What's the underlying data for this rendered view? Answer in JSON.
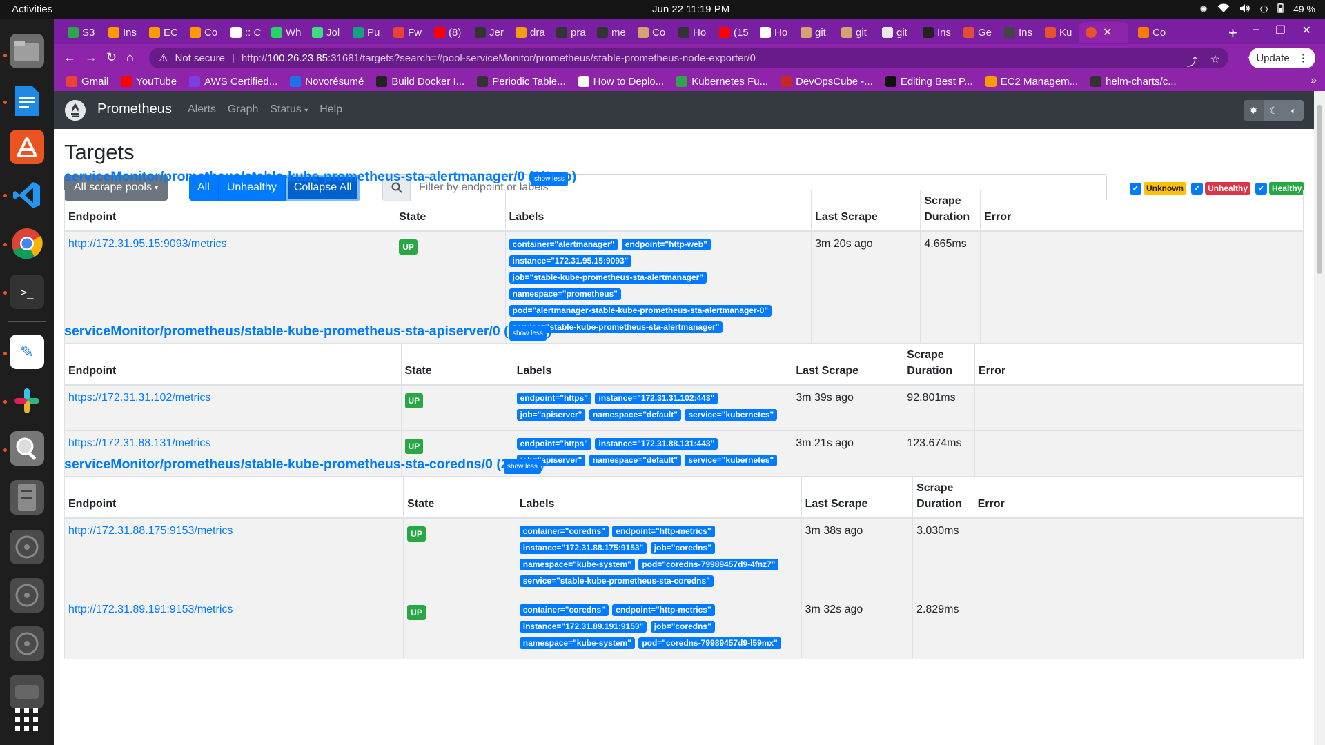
{
  "system": {
    "activities": "Activities",
    "clock": "Jun 22  11:19 PM",
    "battery": "49 %"
  },
  "browser": {
    "tabs": [
      {
        "label": "S3",
        "color": "#2ea44f"
      },
      {
        "label": "Ins",
        "color": "#ff9900"
      },
      {
        "label": "EC",
        "color": "#ff9900"
      },
      {
        "label": "Co",
        "color": "#ff9900"
      },
      {
        "label": ":: C",
        "color": "#ffffff"
      },
      {
        "label": "Wh",
        "color": "#25d366"
      },
      {
        "label": "Jol",
        "color": "#3ddc84"
      },
      {
        "label": "Pu",
        "color": "#10a37f"
      },
      {
        "label": "Fw",
        "color": "#ea4335"
      },
      {
        "label": "(8)",
        "color": "#ff0000"
      },
      {
        "label": "Jer",
        "color": "#333333"
      },
      {
        "label": "dra",
        "color": "#f59e0b"
      },
      {
        "label": "pra",
        "color": "#333333"
      },
      {
        "label": "me",
        "color": "#333333"
      },
      {
        "label": "Co",
        "color": "#d4a373"
      },
      {
        "label": "Ho",
        "color": "#333333"
      },
      {
        "label": "(15",
        "color": "#ff0000"
      },
      {
        "label": "Ho",
        "color": "#ffffff"
      },
      {
        "label": "git",
        "color": "#d4a373"
      },
      {
        "label": "git",
        "color": "#d4a373"
      },
      {
        "label": "git",
        "color": "#e8e8e8"
      },
      {
        "label": "Ins",
        "color": "#222222"
      },
      {
        "label": "Ge",
        "color": "#e04e39"
      },
      {
        "label": "Ins",
        "color": "#444444"
      },
      {
        "label": "Ku",
        "color": "#e6522c"
      }
    ],
    "active_tab": {
      "label": "",
      "color": "#e6522c"
    },
    "last_tab": {
      "label": "Co",
      "color": "#f57c00"
    },
    "address": {
      "not_secure": "Not secure",
      "url_prefix": "http://",
      "url_host": "100.26.23.85",
      "url_rest": ":31681/targets?search=#pool-serviceMonitor/prometheus/stable-prometheus-node-exporter/0"
    },
    "update_label": "Update",
    "bookmarks": [
      {
        "label": "Gmail",
        "color": "#ea4335"
      },
      {
        "label": "YouTube",
        "color": "#ff0000"
      },
      {
        "label": "AWS Certified...",
        "color": "#7b3fe4"
      },
      {
        "label": "Novorésumé",
        "color": "#1a73e8"
      },
      {
        "label": "Build Docker I...",
        "color": "#222222"
      },
      {
        "label": "Periodic Table...",
        "color": "#333333"
      },
      {
        "label": "How to Deplo...",
        "color": "#ffffff"
      },
      {
        "label": "Kubernetes Fu...",
        "color": "#2ea44f"
      },
      {
        "label": "DevOpsCube -...",
        "color": "#c62828"
      },
      {
        "label": "Editing Best P...",
        "color": "#111111"
      },
      {
        "label": "EC2 Managem...",
        "color": "#ff9900"
      },
      {
        "label": "helm-charts/c...",
        "color": "#333333"
      }
    ]
  },
  "prometheus": {
    "brand": "Prometheus",
    "nav": [
      "Alerts",
      "Graph",
      "Status",
      "Help"
    ],
    "page_title": "Targets",
    "pool_button": "All scrape pools",
    "filters": [
      "All",
      "Unhealthy",
      "Collapse All"
    ],
    "search_placeholder": "Filter by endpoint or labels",
    "health_filters": [
      "Unknown",
      "Unhealthy",
      "Healthy"
    ],
    "show_less": "show less",
    "columns": [
      "Endpoint",
      "State",
      "Labels",
      "Last Scrape",
      "Scrape Duration",
      "Error"
    ],
    "pools": [
      {
        "title": "serviceMonitor/prometheus/stable-kube-prometheus-sta-alertmanager/0 (1/1 up)",
        "targets": [
          {
            "endpoint": "http://172.31.95.15:9093/metrics",
            "state": "UP",
            "labels": [
              "container=\"alertmanager\"",
              "endpoint=\"http-web\"",
              "instance=\"172.31.95.15:9093\"",
              "job=\"stable-kube-prometheus-sta-alertmanager\"",
              "namespace=\"prometheus\"",
              "pod=\"alertmanager-stable-kube-prometheus-sta-alertmanager-0\"",
              "service=\"stable-kube-prometheus-sta-alertmanager\""
            ],
            "last_scrape": "3m 20s ago",
            "duration": "4.665ms",
            "error": ""
          }
        ]
      },
      {
        "title": "serviceMonitor/prometheus/stable-kube-prometheus-sta-apiserver/0 (2/2 up)",
        "targets": [
          {
            "endpoint": "https://172.31.31.102/metrics",
            "state": "UP",
            "labels": [
              "endpoint=\"https\"",
              "instance=\"172.31.31.102:443\"",
              "job=\"apiserver\"",
              "namespace=\"default\"",
              "service=\"kubernetes\""
            ],
            "last_scrape": "3m 39s ago",
            "duration": "92.801ms",
            "error": ""
          },
          {
            "endpoint": "https://172.31.88.131/metrics",
            "state": "UP",
            "labels": [
              "endpoint=\"https\"",
              "instance=\"172.31.88.131:443\"",
              "job=\"apiserver\"",
              "namespace=\"default\"",
              "service=\"kubernetes\""
            ],
            "last_scrape": "3m 21s ago",
            "duration": "123.674ms",
            "error": ""
          }
        ]
      },
      {
        "title": "serviceMonitor/prometheus/stable-kube-prometheus-sta-coredns/0 (2/2 up)",
        "targets": [
          {
            "endpoint": "http://172.31.88.175:9153/metrics",
            "state": "UP",
            "labels": [
              "container=\"coredns\"",
              "endpoint=\"http-metrics\"",
              "instance=\"172.31.88.175:9153\"",
              "job=\"coredns\"",
              "namespace=\"kube-system\"",
              "pod=\"coredns-79989457d9-4fnz7\"",
              "service=\"stable-kube-prometheus-sta-coredns\""
            ],
            "last_scrape": "3m 38s ago",
            "duration": "3.030ms",
            "error": ""
          },
          {
            "endpoint": "http://172.31.89.191:9153/metrics",
            "state": "UP",
            "labels": [
              "container=\"coredns\"",
              "endpoint=\"http-metrics\"",
              "instance=\"172.31.89.191:9153\"",
              "job=\"coredns\"",
              "namespace=\"kube-system\"",
              "pod=\"coredns-79989457d9-l59mx\""
            ],
            "last_scrape": "3m 32s ago",
            "duration": "2.829ms",
            "error": ""
          }
        ]
      }
    ]
  },
  "dock": {
    "apps": [
      "files-icon",
      "writer-icon",
      "software-icon",
      "vscode-icon",
      "chrome-icon",
      "terminal-icon",
      "text-editor-icon",
      "slack-icon",
      "search-app-icon",
      "disk-icon",
      "drive-icon",
      "drive-icon",
      "drive-icon",
      "drive-icon",
      "app-grid-icon"
    ]
  }
}
